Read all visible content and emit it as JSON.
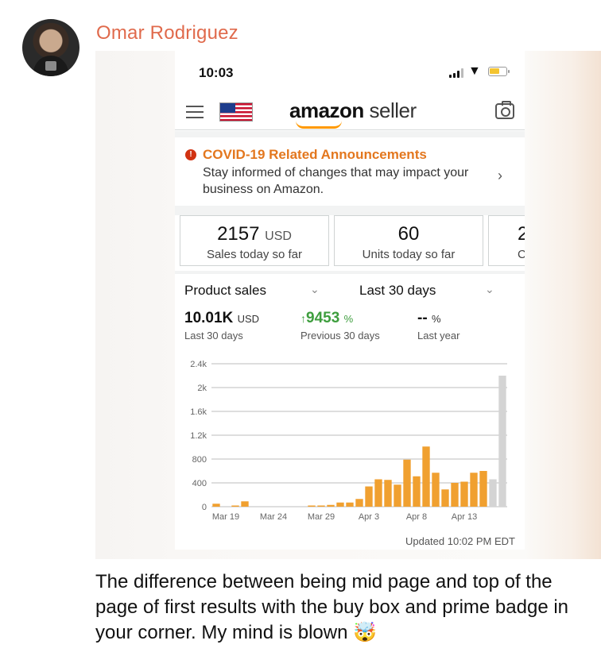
{
  "message": {
    "author": "Omar Rodriguez",
    "caption": "The difference between being mid page and top of the page of first results with the buy box and prime badge in your corner. My mind is blown",
    "caption_emoji": "🤯"
  },
  "phone": {
    "status": {
      "time": "10:03",
      "icons": [
        "signal-icon",
        "wifi-icon",
        "battery-icon"
      ]
    },
    "appbar": {
      "brand_bold": "amazon",
      "brand_light": " seller",
      "icons": [
        "hamburger-menu-icon",
        "us-flag-icon",
        "camera-icon"
      ]
    },
    "covid": {
      "alert_icon": "!",
      "title": "COVID-19 Related Announcements",
      "description": "Stay informed of changes that may impact your business on Amazon.",
      "chevron": "›"
    },
    "metrics": [
      {
        "value": "2157",
        "unit": "USD",
        "label": "Sales today so far"
      },
      {
        "value": "60",
        "unit": "",
        "label": "Units today so far"
      },
      {
        "value": "2",
        "unit": "",
        "label": "C"
      }
    ],
    "selectors": {
      "metric": "Product sales",
      "range": "Last 30 days",
      "chevron": "⌄"
    },
    "kpis": [
      {
        "value": "10.01K",
        "unit": "USD",
        "label": "Last 30 days"
      },
      {
        "arrow": "↑",
        "value": "9453",
        "unit": "%",
        "label": "Previous 30 days"
      },
      {
        "value": "--",
        "unit": "%",
        "label": "Last year"
      }
    ],
    "updated": "Updated 10:02 PM EDT"
  },
  "colors": {
    "author": "#e06a4c",
    "accent_orange": "#f0a030",
    "today_bar": "#d4d4d4",
    "alert_title": "#e3771e",
    "positive_green": "#3e9e3e"
  },
  "chart_data": {
    "type": "bar",
    "title": "",
    "xlabel": "",
    "ylabel": "",
    "ylim": [
      0,
      2400
    ],
    "yticks": [
      "2.4k",
      "2k",
      "1.6k",
      "1.2k",
      "800",
      "400",
      "0"
    ],
    "xtick_labels": [
      "Mar 19",
      "Mar 24",
      "Mar 29",
      "Apr 3",
      "Apr 8",
      "Apr 13"
    ],
    "categories": [
      "Mar 18",
      "Mar 19",
      "Mar 20",
      "Mar 21",
      "Mar 22",
      "Mar 23",
      "Mar 24",
      "Mar 25",
      "Mar 26",
      "Mar 27",
      "Mar 28",
      "Mar 29",
      "Mar 30",
      "Mar 31",
      "Apr 1",
      "Apr 2",
      "Apr 3",
      "Apr 4",
      "Apr 5",
      "Apr 6",
      "Apr 7",
      "Apr 8",
      "Apr 9",
      "Apr 10",
      "Apr 11",
      "Apr 12",
      "Apr 13",
      "Apr 14",
      "Apr 15",
      "Apr 16",
      "Apr 17"
    ],
    "values": [
      50,
      0,
      20,
      90,
      0,
      0,
      0,
      0,
      0,
      0,
      20,
      20,
      30,
      70,
      70,
      130,
      340,
      460,
      450,
      370,
      790,
      510,
      1010,
      570,
      290,
      400,
      420,
      570,
      600,
      460,
      2200
    ],
    "highlight_last_two": true,
    "grid": true
  }
}
